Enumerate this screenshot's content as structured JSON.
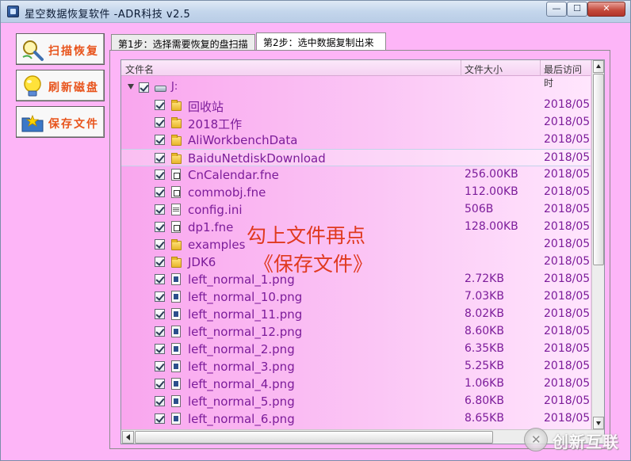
{
  "window": {
    "title": "星空数据恢复软件   -ADR科技 v2.5",
    "controls": {
      "minimize": "—",
      "maximize": "☐",
      "close": "✕"
    }
  },
  "sidebar": {
    "buttons": [
      {
        "id": "scan",
        "label": "扫描恢复",
        "icon": "magnifier-icon"
      },
      {
        "id": "refresh",
        "label": "刷新磁盘",
        "icon": "lightbulb-icon"
      },
      {
        "id": "save",
        "label": "保存文件",
        "icon": "folder-star-icon"
      }
    ]
  },
  "tabs": [
    {
      "label": "第1步：选择需要恢复的盘扫描",
      "active": false
    },
    {
      "label": "第2步：选中数据复制出来",
      "active": true
    }
  ],
  "table": {
    "columns": {
      "name": "文件名",
      "size": "文件大小",
      "date": "最后访问时"
    },
    "drive": {
      "label": "J:",
      "checked": true,
      "expanded": true
    },
    "rows": [
      {
        "type": "folder",
        "name": "回收站",
        "size": "",
        "date": "2018/05",
        "checked": true
      },
      {
        "type": "folder",
        "name": "2018工作",
        "size": "",
        "date": "2018/05",
        "checked": true
      },
      {
        "type": "folder",
        "name": "AliWorkbenchData",
        "size": "",
        "date": "2018/05",
        "checked": true
      },
      {
        "type": "folder",
        "name": "BaiduNetdiskDownload",
        "size": "",
        "date": "2018/05",
        "checked": true,
        "selected": true
      },
      {
        "type": "file",
        "name": "CnCalendar.fne",
        "size": "256.00KB",
        "date": "2018/05",
        "checked": true
      },
      {
        "type": "file",
        "name": "commobj.fne",
        "size": "112.00KB",
        "date": "2018/05",
        "checked": true
      },
      {
        "type": "ini",
        "name": "config.ini",
        "size": "506B",
        "date": "2018/05",
        "checked": true
      },
      {
        "type": "file",
        "name": "dp1.fne",
        "size": "128.00KB",
        "date": "2018/05",
        "checked": true
      },
      {
        "type": "folder",
        "name": "examples",
        "size": "",
        "date": "2018/05",
        "checked": true
      },
      {
        "type": "folder",
        "name": "JDK6",
        "size": "",
        "date": "2018/05",
        "checked": true
      },
      {
        "type": "png",
        "name": "left_normal_1.png",
        "size": "2.72KB",
        "date": "2018/05",
        "checked": true
      },
      {
        "type": "png",
        "name": "left_normal_10.png",
        "size": "7.03KB",
        "date": "2018/05",
        "checked": true
      },
      {
        "type": "png",
        "name": "left_normal_11.png",
        "size": "8.02KB",
        "date": "2018/05",
        "checked": true
      },
      {
        "type": "png",
        "name": "left_normal_12.png",
        "size": "8.60KB",
        "date": "2018/05",
        "checked": true
      },
      {
        "type": "png",
        "name": "left_normal_2.png",
        "size": "6.35KB",
        "date": "2018/05",
        "checked": true
      },
      {
        "type": "png",
        "name": "left_normal_3.png",
        "size": "5.25KB",
        "date": "2018/05",
        "checked": true
      },
      {
        "type": "png",
        "name": "left_normal_4.png",
        "size": "1.06KB",
        "date": "2018/05",
        "checked": true
      },
      {
        "type": "png",
        "name": "left_normal_5.png",
        "size": "6.80KB",
        "date": "2018/05",
        "checked": true
      },
      {
        "type": "png",
        "name": "left_normal_6.png",
        "size": "8.65KB",
        "date": "2018/05",
        "checked": true
      }
    ]
  },
  "annotation": {
    "line1": "勾上文件再点",
    "line2": "《保存文件》"
  },
  "watermark": {
    "text": "创新互联"
  },
  "colors": {
    "background": "#fdb5f7",
    "list_text": "#7c1c9a",
    "button_label": "#e8541c",
    "annotation": "#e0391f"
  }
}
